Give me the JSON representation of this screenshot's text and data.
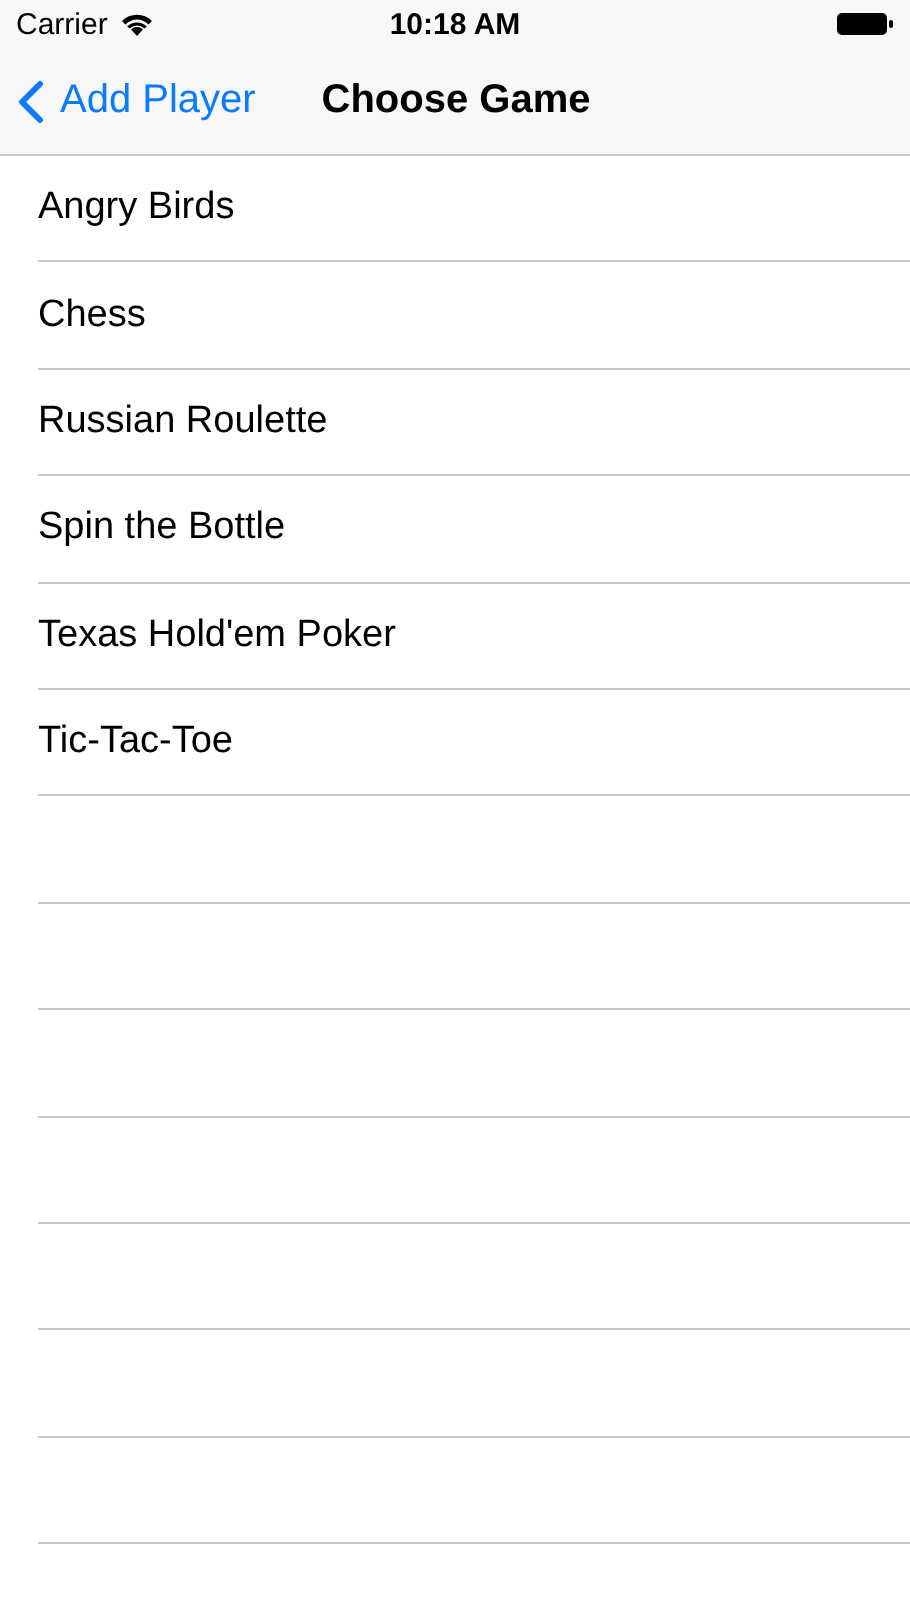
{
  "status_bar": {
    "carrier": "Carrier",
    "time": "10:18 AM"
  },
  "nav_bar": {
    "back_label": "Add Player",
    "title": "Choose Game"
  },
  "games": [
    {
      "name": "Angry Birds"
    },
    {
      "name": "Chess"
    },
    {
      "name": "Russian Roulette"
    },
    {
      "name": "Spin the Bottle"
    },
    {
      "name": "Texas Hold'em Poker"
    },
    {
      "name": "Tic-Tac-Toe"
    }
  ]
}
